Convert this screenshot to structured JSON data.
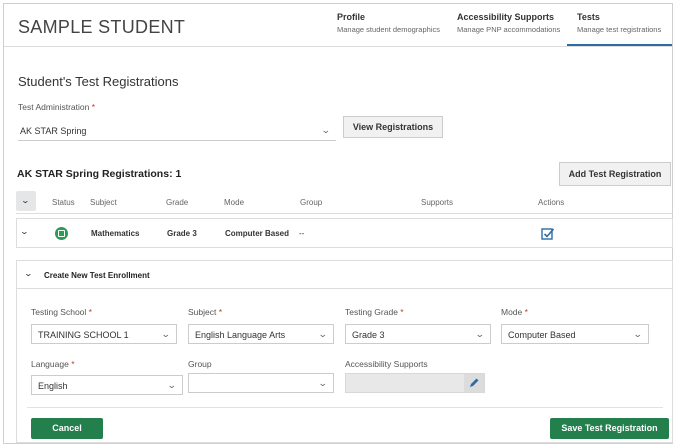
{
  "header": {
    "student_name": "SAMPLE STUDENT",
    "tabs": [
      {
        "title": "Profile",
        "subtitle": "Manage student demographics"
      },
      {
        "title": "Accessibility Supports",
        "subtitle": "Manage PNP accommodations"
      },
      {
        "title": "Tests",
        "subtitle": "Manage test registrations"
      }
    ]
  },
  "registrations": {
    "section_title": "Student's Test Registrations",
    "test_admin_label": "Test Administration",
    "required_mark": "*",
    "test_admin_value": "AK STAR Spring",
    "view_button": "View Registrations",
    "list_title": "AK STAR Spring Registrations: 1",
    "add_button": "Add Test Registration",
    "columns": [
      "Status",
      "Subject",
      "Grade",
      "Mode",
      "Group",
      "Supports",
      "Actions"
    ],
    "row": {
      "subject": "Mathematics",
      "grade": "Grade 3",
      "mode": "Computer Based",
      "group": "--"
    }
  },
  "enrollment": {
    "title": "Create New Test Enrollment",
    "testing_school_label": "Testing School",
    "testing_school_value": "TRAINING SCHOOL 1",
    "subject_label": "Subject",
    "subject_value": "English Language Arts",
    "testing_grade_label": "Testing Grade",
    "testing_grade_value": "Grade 3",
    "mode_label": "Mode",
    "mode_value": "Computer Based",
    "language_label": "Language",
    "language_value": "English",
    "group_label": "Group",
    "group_value": "",
    "supports_label": "Accessibility Supports",
    "cancel_button": "Cancel",
    "save_button": "Save Test Registration"
  },
  "colors": {
    "accent_green": "#237f4b",
    "status_icon_green": "#2e9a57",
    "edit_icon_blue": "#2e6da4"
  }
}
